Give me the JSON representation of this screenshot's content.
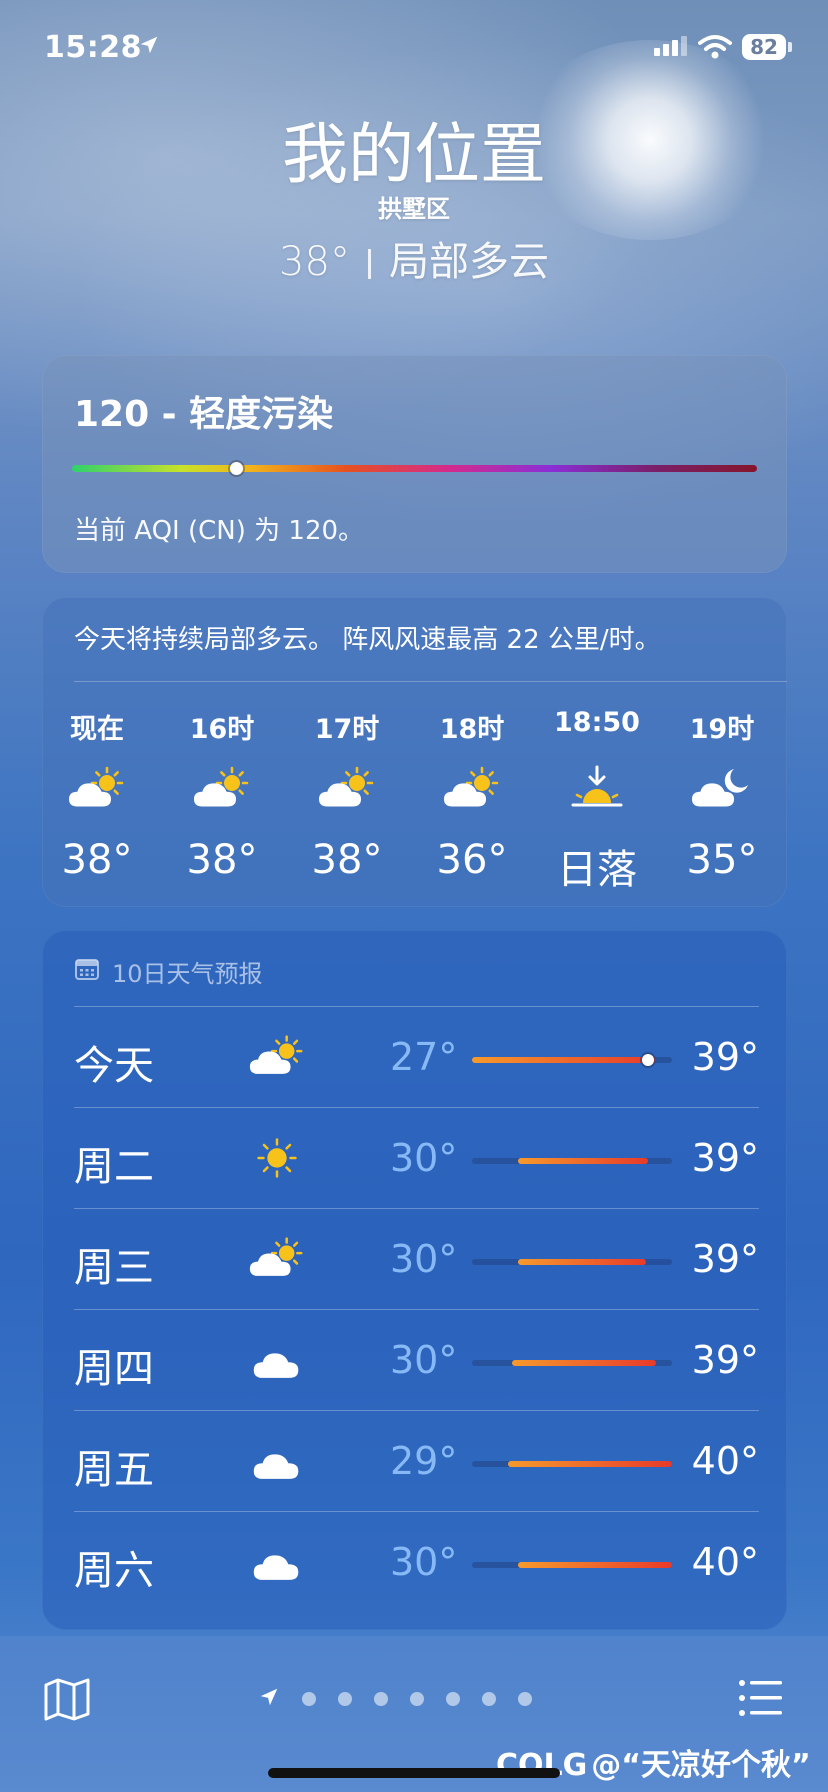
{
  "status_bar": {
    "time": "15:28",
    "battery": "82"
  },
  "header": {
    "title": "我的位置",
    "district": "拱墅区",
    "temperature": "38°",
    "condition": "局部多云"
  },
  "aqi": {
    "title": "120 - 轻度污染",
    "description": "当前 AQI (CN) 为 120。",
    "level": 0.24
  },
  "hourly": {
    "summary": "今天将持续局部多云。 阵风风速最高 22 公里/时。",
    "items": [
      {
        "label": "现在",
        "icon": "partly-cloudy-sun-icon",
        "temp": "38°"
      },
      {
        "label": "16时",
        "icon": "partly-cloudy-sun-icon",
        "temp": "38°"
      },
      {
        "label": "17时",
        "icon": "partly-cloudy-sun-icon",
        "temp": "38°"
      },
      {
        "label": "18时",
        "icon": "partly-cloudy-sun-icon",
        "temp": "36°"
      },
      {
        "label": "18:50",
        "icon": "sunset-icon",
        "temp": "日落"
      },
      {
        "label": "19时",
        "icon": "partly-cloudy-moon-icon",
        "temp": "35°"
      }
    ]
  },
  "forecast": {
    "header": "10日天气预报",
    "rows": [
      {
        "day": "今天",
        "icon": "partly-cloudy-sun-icon",
        "low": "27°",
        "high": "39°",
        "range_start": 0.0,
        "range_end": 0.92,
        "current_pos": 0.88
      },
      {
        "day": "周二",
        "icon": "sun-icon",
        "low": "30°",
        "high": "39°",
        "range_start": 0.23,
        "range_end": 0.88
      },
      {
        "day": "周三",
        "icon": "partly-cloudy-sun-icon",
        "low": "30°",
        "high": "39°",
        "range_start": 0.23,
        "range_end": 0.87
      },
      {
        "day": "周四",
        "icon": "cloud-icon",
        "low": "30°",
        "high": "39°",
        "range_start": 0.2,
        "range_end": 0.92
      },
      {
        "day": "周五",
        "icon": "cloud-icon",
        "low": "29°",
        "high": "40°",
        "range_start": 0.18,
        "range_end": 1.0
      },
      {
        "day": "周六",
        "icon": "cloud-icon",
        "low": "30°",
        "high": "40°",
        "range_start": 0.23,
        "range_end": 1.0
      }
    ]
  },
  "watermark": {
    "brand": "COLG",
    "text": "@“天凉好个秋”"
  },
  "colors": {
    "sun": "#f7c21a",
    "bar_start": "#f79a2c",
    "bar_end": "#e83a2a"
  }
}
